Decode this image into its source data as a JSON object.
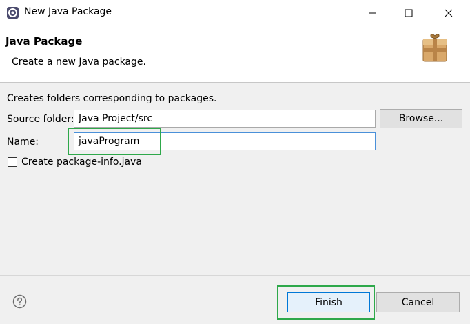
{
  "window": {
    "title": "New Java Package",
    "icon": "eclipse-icon"
  },
  "header": {
    "title": "Java Package",
    "description": "Create a new Java package.",
    "icon": "package-icon"
  },
  "form": {
    "description": "Creates folders corresponding to packages.",
    "source_folder_label": "Source folder:",
    "source_folder_value": "Java Project/src",
    "browse_label": "Browse...",
    "name_label": "Name:",
    "name_value": "javaProgram",
    "create_package_info_label": "Create package-info.java",
    "create_package_info_checked": false
  },
  "footer": {
    "help_icon": "help-icon",
    "finish_label": "Finish",
    "cancel_label": "Cancel"
  },
  "colors": {
    "highlight": "#2ea84a",
    "focus_border": "#4a90d9",
    "dialog_bg": "#f0f0f0"
  }
}
